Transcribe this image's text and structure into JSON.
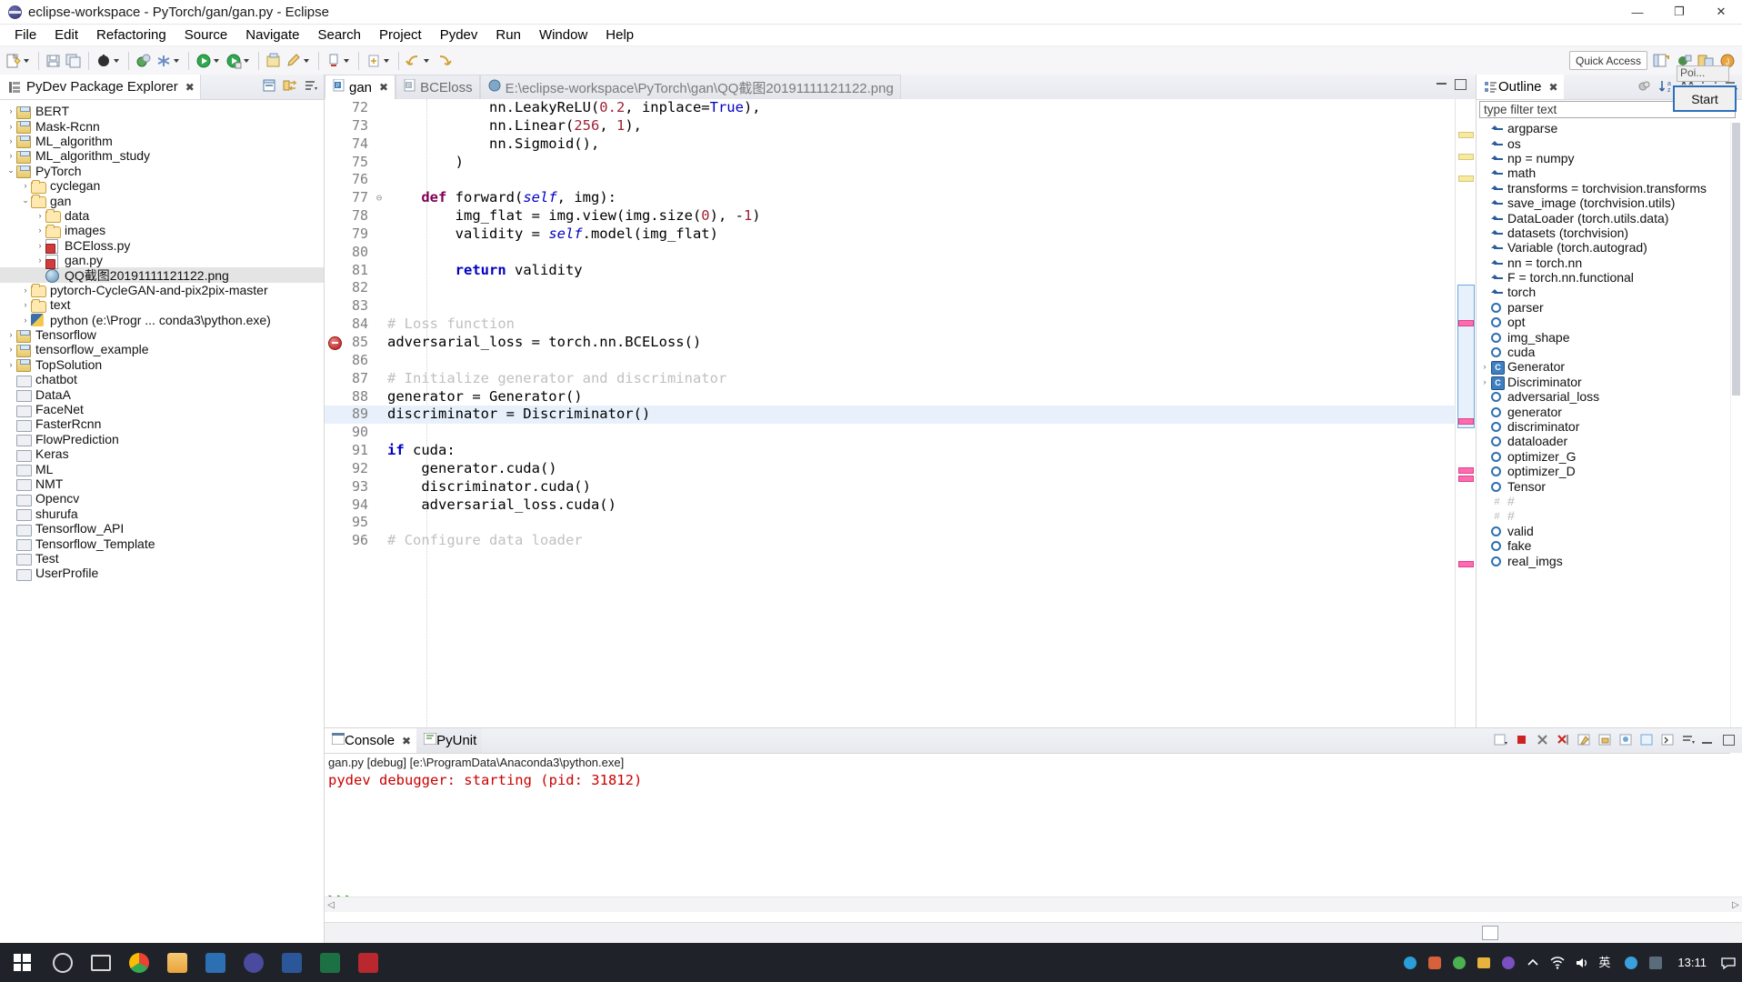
{
  "window": {
    "title": "eclipse-workspace - PyTorch/gan/gan.py - Eclipse",
    "minimize": "—",
    "maximize": "❐",
    "close": "✕"
  },
  "menubar": {
    "items": [
      "File",
      "Edit",
      "Refactoring",
      "Source",
      "Navigate",
      "Search",
      "Project",
      "Pydev",
      "Run",
      "Window",
      "Help"
    ]
  },
  "toolbar": {
    "quick_access": "Quick Access"
  },
  "explorer": {
    "tab_label": "PyDev Package Explorer",
    "tree": [
      {
        "indent": 0,
        "arrow": "›",
        "icon": "project-icon",
        "label": "BERT"
      },
      {
        "indent": 0,
        "arrow": "›",
        "icon": "project-icon",
        "label": "Mask-Rcnn"
      },
      {
        "indent": 0,
        "arrow": "›",
        "icon": "project-icon",
        "label": "ML_algorithm"
      },
      {
        "indent": 0,
        "arrow": "›",
        "icon": "project-icon",
        "label": "ML_algorithm_study"
      },
      {
        "indent": 0,
        "arrow": "⌄",
        "icon": "project-icon",
        "label": "PyTorch"
      },
      {
        "indent": 1,
        "arrow": "›",
        "icon": "folder-icon",
        "label": "cyclegan"
      },
      {
        "indent": 1,
        "arrow": "⌄",
        "icon": "folder-icon",
        "label": "gan"
      },
      {
        "indent": 2,
        "arrow": "›",
        "icon": "folder-icon",
        "label": "data"
      },
      {
        "indent": 2,
        "arrow": "›",
        "icon": "folder-icon",
        "label": "images"
      },
      {
        "indent": 2,
        "arrow": "›",
        "icon": "python-file-icon",
        "label": "BCEloss.py"
      },
      {
        "indent": 2,
        "arrow": "›",
        "icon": "python-file-icon",
        "label": "gan.py"
      },
      {
        "indent": 2,
        "arrow": "",
        "icon": "image-file-icon",
        "label": "QQ截图20191111121122.png",
        "selected": true
      },
      {
        "indent": 1,
        "arrow": "›",
        "icon": "folder-icon",
        "label": "pytorch-CycleGAN-and-pix2pix-master"
      },
      {
        "indent": 1,
        "arrow": "›",
        "icon": "folder-icon",
        "label": "text"
      },
      {
        "indent": 1,
        "arrow": "›",
        "icon": "python-interpreter-icon",
        "label": "python  (e:\\Progr ... conda3\\python.exe)"
      },
      {
        "indent": 0,
        "arrow": "›",
        "icon": "project-icon",
        "label": "Tensorflow"
      },
      {
        "indent": 0,
        "arrow": "›",
        "icon": "project-icon",
        "label": "tensorflow_example"
      },
      {
        "indent": 0,
        "arrow": "›",
        "icon": "project-icon",
        "label": "TopSolution"
      },
      {
        "indent": 0,
        "arrow": "",
        "icon": "grey-folder-icon",
        "label": "chatbot"
      },
      {
        "indent": 0,
        "arrow": "",
        "icon": "grey-folder-icon",
        "label": "DataA"
      },
      {
        "indent": 0,
        "arrow": "",
        "icon": "grey-folder-icon",
        "label": "FaceNet"
      },
      {
        "indent": 0,
        "arrow": "",
        "icon": "grey-folder-icon",
        "label": "FasterRcnn"
      },
      {
        "indent": 0,
        "arrow": "",
        "icon": "grey-folder-icon",
        "label": "FlowPrediction"
      },
      {
        "indent": 0,
        "arrow": "",
        "icon": "grey-folder-icon",
        "label": "Keras"
      },
      {
        "indent": 0,
        "arrow": "",
        "icon": "grey-folder-icon",
        "label": "ML"
      },
      {
        "indent": 0,
        "arrow": "",
        "icon": "grey-folder-icon",
        "label": "NMT"
      },
      {
        "indent": 0,
        "arrow": "",
        "icon": "grey-folder-icon",
        "label": "Opencv"
      },
      {
        "indent": 0,
        "arrow": "",
        "icon": "grey-folder-icon",
        "label": "shurufa"
      },
      {
        "indent": 0,
        "arrow": "",
        "icon": "grey-folder-icon",
        "label": "Tensorflow_API"
      },
      {
        "indent": 0,
        "arrow": "",
        "icon": "grey-folder-icon",
        "label": "Tensorflow_Template"
      },
      {
        "indent": 0,
        "arrow": "",
        "icon": "grey-folder-icon",
        "label": "Test"
      },
      {
        "indent": 0,
        "arrow": "",
        "icon": "grey-folder-icon",
        "label": "UserProfile"
      }
    ]
  },
  "editor": {
    "tabs": [
      {
        "label": "gan",
        "active": true,
        "closable": true
      },
      {
        "label": "BCEloss",
        "active": false,
        "closable": false
      },
      {
        "label": "E:\\eclipse-workspace\\PyTorch\\gan\\QQ截图20191111121122.png",
        "active": false,
        "closable": false
      }
    ],
    "lines": [
      {
        "n": "72",
        "fold": "",
        "segments": [
          {
            "t": "            nn.LeakyReLU(",
            "c": ""
          },
          {
            "t": "0.2",
            "c": "num"
          },
          {
            "t": ", inplace=",
            "c": ""
          },
          {
            "t": "True",
            "c": "builtin"
          },
          {
            "t": "),",
            "c": ""
          }
        ]
      },
      {
        "n": "73",
        "fold": "",
        "segments": [
          {
            "t": "            nn.Linear(",
            "c": ""
          },
          {
            "t": "256",
            "c": "num"
          },
          {
            "t": ", ",
            "c": ""
          },
          {
            "t": "1",
            "c": "num"
          },
          {
            "t": "),",
            "c": ""
          }
        ]
      },
      {
        "n": "74",
        "fold": "",
        "segments": [
          {
            "t": "            nn.Sigmoid(),",
            "c": ""
          }
        ]
      },
      {
        "n": "75",
        "fold": "",
        "segments": [
          {
            "t": "        )",
            "c": ""
          }
        ]
      },
      {
        "n": "76",
        "fold": "",
        "segments": [
          {
            "t": "",
            "c": ""
          }
        ]
      },
      {
        "n": "77",
        "fold": "⊖",
        "segments": [
          {
            "t": "    ",
            "c": ""
          },
          {
            "t": "def",
            "c": "kw"
          },
          {
            "t": " forward(",
            "c": ""
          },
          {
            "t": "self",
            "c": "self"
          },
          {
            "t": ", img):",
            "c": ""
          }
        ]
      },
      {
        "n": "78",
        "fold": "",
        "segments": [
          {
            "t": "        img_flat = img.view(img.size(",
            "c": ""
          },
          {
            "t": "0",
            "c": "num"
          },
          {
            "t": "), -",
            "c": ""
          },
          {
            "t": "1",
            "c": "num"
          },
          {
            "t": ")",
            "c": ""
          }
        ]
      },
      {
        "n": "79",
        "fold": "",
        "segments": [
          {
            "t": "        validity = ",
            "c": ""
          },
          {
            "t": "self",
            "c": "self"
          },
          {
            "t": ".model(img_flat)",
            "c": ""
          }
        ]
      },
      {
        "n": "80",
        "fold": "",
        "segments": [
          {
            "t": "",
            "c": ""
          }
        ]
      },
      {
        "n": "81",
        "fold": "",
        "segments": [
          {
            "t": "        ",
            "c": ""
          },
          {
            "t": "return",
            "c": "kwb"
          },
          {
            "t": " validity",
            "c": ""
          }
        ]
      },
      {
        "n": "82",
        "fold": "",
        "segments": [
          {
            "t": "",
            "c": ""
          }
        ]
      },
      {
        "n": "83",
        "fold": "",
        "segments": [
          {
            "t": "",
            "c": ""
          }
        ]
      },
      {
        "n": "84",
        "fold": "",
        "segments": [
          {
            "t": "# Loss function",
            "c": "cmt"
          }
        ]
      },
      {
        "n": "85",
        "fold": "",
        "error": true,
        "segments": [
          {
            "t": "adversarial_loss = torch.nn.BCELoss()",
            "c": ""
          }
        ]
      },
      {
        "n": "86",
        "fold": "",
        "segments": [
          {
            "t": "",
            "c": ""
          }
        ]
      },
      {
        "n": "87",
        "fold": "",
        "segments": [
          {
            "t": "# Initialize generator and discriminator",
            "c": "cmt"
          }
        ]
      },
      {
        "n": "88",
        "fold": "",
        "segments": [
          {
            "t": "generator = Generator()",
            "c": ""
          }
        ]
      },
      {
        "n": "89",
        "fold": "",
        "highlight": true,
        "segments": [
          {
            "t": "discriminator = Discriminator()",
            "c": ""
          }
        ]
      },
      {
        "n": "90",
        "fold": "",
        "segments": [
          {
            "t": "",
            "c": ""
          }
        ]
      },
      {
        "n": "91",
        "fold": "",
        "segments": [
          {
            "t": "",
            "c": ""
          },
          {
            "t": "if",
            "c": "kwb"
          },
          {
            "t": " cuda:",
            "c": ""
          }
        ]
      },
      {
        "n": "92",
        "fold": "",
        "segments": [
          {
            "t": "    generator.cuda()",
            "c": ""
          }
        ]
      },
      {
        "n": "93",
        "fold": "",
        "segments": [
          {
            "t": "    discriminator.cuda()",
            "c": ""
          }
        ]
      },
      {
        "n": "94",
        "fold": "",
        "segments": [
          {
            "t": "    adversarial_loss.cuda()",
            "c": ""
          }
        ]
      },
      {
        "n": "95",
        "fold": "",
        "segments": [
          {
            "t": "",
            "c": ""
          }
        ]
      },
      {
        "n": "96",
        "fold": "",
        "segments": [
          {
            "t": "# Configure data loader",
            "c": "cmt"
          }
        ]
      }
    ]
  },
  "outline": {
    "tab_label": "Outline",
    "filter_placeholder": "type filter text",
    "start_button": "Start",
    "point_tooltip": "Poi...",
    "items": [
      {
        "icon": "import-icon",
        "label": "argparse",
        "expandable": false
      },
      {
        "icon": "import-icon",
        "label": "os",
        "expandable": false
      },
      {
        "icon": "import-icon",
        "label": "np = numpy",
        "expandable": false
      },
      {
        "icon": "import-icon",
        "label": "math",
        "expandable": false
      },
      {
        "icon": "import-icon",
        "label": "transforms = torchvision.transforms",
        "expandable": false
      },
      {
        "icon": "import-icon",
        "label": "save_image (torchvision.utils)",
        "expandable": false
      },
      {
        "icon": "import-icon",
        "label": "DataLoader (torch.utils.data)",
        "expandable": false
      },
      {
        "icon": "import-icon",
        "label": "datasets (torchvision)",
        "expandable": false
      },
      {
        "icon": "import-icon",
        "label": "Variable (torch.autograd)",
        "expandable": false
      },
      {
        "icon": "import-icon",
        "label": "nn = torch.nn",
        "expandable": false
      },
      {
        "icon": "import-icon",
        "label": "F = torch.nn.functional",
        "expandable": false
      },
      {
        "icon": "import-icon",
        "label": "torch",
        "expandable": false
      },
      {
        "icon": "attribute-icon",
        "label": "parser",
        "expandable": false
      },
      {
        "icon": "attribute-icon",
        "label": "opt",
        "expandable": false
      },
      {
        "icon": "attribute-icon",
        "label": "img_shape",
        "expandable": false
      },
      {
        "icon": "attribute-icon",
        "label": "cuda",
        "expandable": false
      },
      {
        "icon": "class-icon",
        "label": "Generator",
        "expandable": true
      },
      {
        "icon": "class-icon",
        "label": "Discriminator",
        "expandable": true
      },
      {
        "icon": "attribute-icon",
        "label": "adversarial_loss",
        "expandable": false
      },
      {
        "icon": "attribute-icon",
        "label": "generator",
        "expandable": false
      },
      {
        "icon": "attribute-icon",
        "label": "discriminator",
        "expandable": false
      },
      {
        "icon": "attribute-icon",
        "label": "dataloader",
        "expandable": false
      },
      {
        "icon": "attribute-icon",
        "label": "optimizer_G",
        "expandable": false
      },
      {
        "icon": "attribute-icon",
        "label": "optimizer_D",
        "expandable": false
      },
      {
        "icon": "attribute-icon",
        "label": "Tensor",
        "expandable": false
      },
      {
        "icon": "comment-icon",
        "label": "#",
        "expandable": false
      },
      {
        "icon": "comment-icon",
        "label": "#",
        "expandable": false
      },
      {
        "icon": "attribute-icon",
        "label": "valid",
        "expandable": false
      },
      {
        "icon": "attribute-icon",
        "label": "fake",
        "expandable": false
      },
      {
        "icon": "attribute-icon",
        "label": "real_imgs",
        "expandable": false
      }
    ]
  },
  "console": {
    "tabs": [
      {
        "label": "Console",
        "active": true
      },
      {
        "label": "PyUnit",
        "active": false
      }
    ],
    "header": "gan.py [debug] [e:\\ProgramData\\Anaconda3\\python.exe]",
    "output": "pydev debugger: starting (pid: 31812)",
    "prompt": ">>>"
  },
  "taskbar": {
    "clock_time": "13:11",
    "clock_date": ""
  },
  "colors": {
    "accent_blue": "#2c6fbb",
    "error_red": "#cc0000",
    "comment_grey": "#c0c0c0",
    "keyword_purple": "#7f0055",
    "keyword_blue": "#0000c0",
    "number_red": "#9d2235",
    "selection_blue": "#e8f1fb",
    "prompt_green": "#1a8c1a"
  }
}
